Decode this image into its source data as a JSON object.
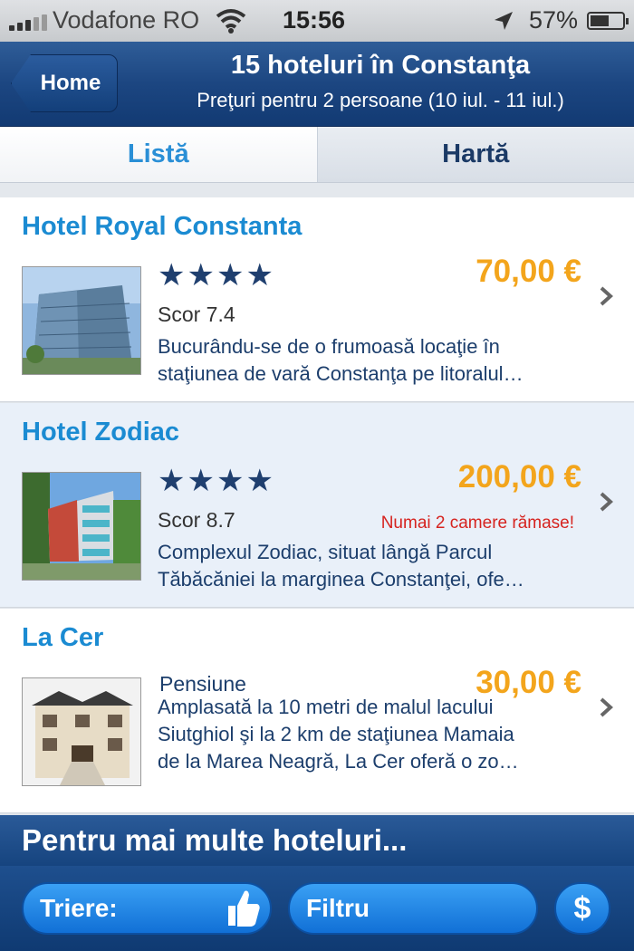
{
  "status_bar": {
    "carrier": "Vodafone RO",
    "time": "15:56",
    "battery_percent": "57%",
    "icons": [
      "signal-icon",
      "wifi-icon",
      "location-arrow-icon",
      "battery-icon"
    ]
  },
  "nav": {
    "back_label": "Home",
    "title": "15 hoteluri în Constanţa",
    "subtitle": "Preţuri pentru 2 persoane (10 iul. - 11 iul.)"
  },
  "tabs": [
    {
      "label": "Listă",
      "active": true
    },
    {
      "label": "Hartă",
      "active": false
    }
  ],
  "hotels": [
    {
      "name": "Hotel Royal Constanta",
      "stars": "★★★★",
      "star_count": 4,
      "score": "Scor 7.4",
      "price": "70,00 €",
      "description_line1": "Bucurându-se de o frumoasă locaţie în",
      "description_line2": "staţiunea de vară Constanţa pe litoralul…"
    },
    {
      "name": "Hotel Zodiac",
      "stars": "★★★★",
      "star_count": 4,
      "score": "Scor 8.7",
      "price": "200,00 €",
      "alert": "Numai 2 camere rămase!",
      "description_line1": "Complexul Zodiac, situat lângă Parcul",
      "description_line2": "Tăbăcăniei la marginea Constanţei, ofe…"
    },
    {
      "name": "La Cer",
      "property_type": "Pensiune",
      "price": "30,00 €",
      "description_line1": "Amplasată la 10 metri de malul lacului",
      "description_line2": "Siutghiol şi la 2 km de staţiunea Mamaia",
      "description_line3": "de la Marea Neagră, La Cer oferă o zo…"
    }
  ],
  "more_banner": "Pentru mai multe hoteluri...",
  "toolbar": {
    "sort_label": "Triere:",
    "filter_label": "Filtru",
    "currency_label": "$"
  },
  "colors": {
    "nav_blue": "#1c4681",
    "link_blue": "#1b8bd2",
    "price_orange": "#f3a51c",
    "alert_red": "#d6231f",
    "button_blue": "#1170d6"
  }
}
